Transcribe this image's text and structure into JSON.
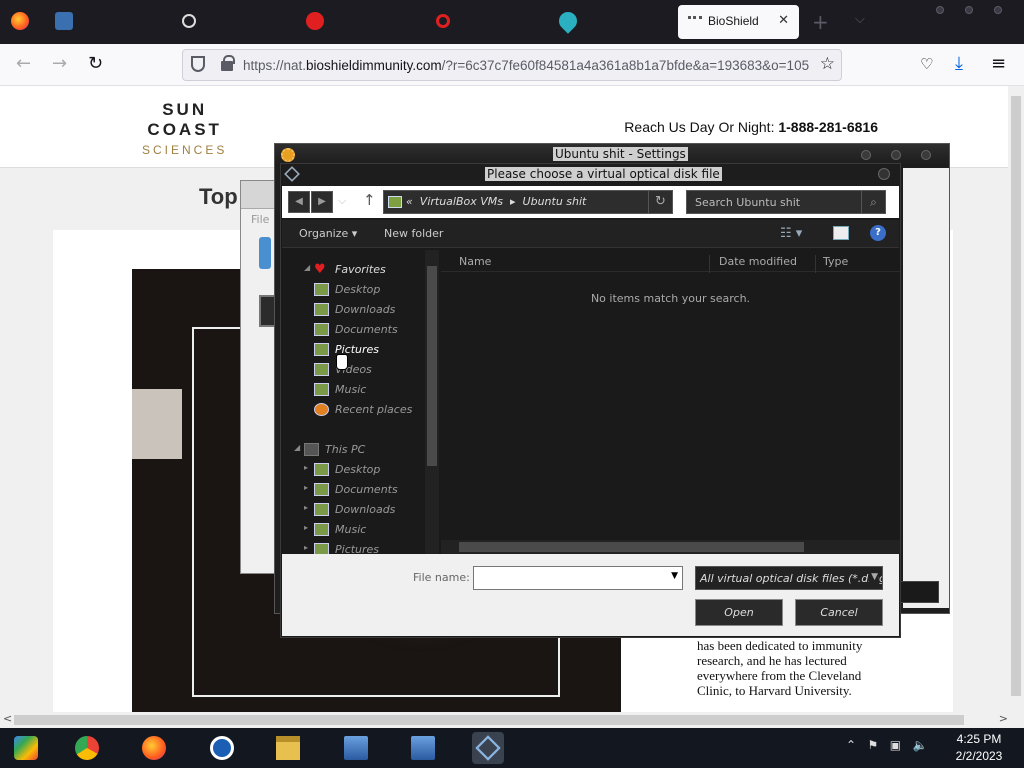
{
  "browser": {
    "active_tab_title": "BioShield",
    "url_prefix": "https://nat.",
    "url_domain": "bioshieldimmunity.com",
    "url_rest": "/?r=6c37c7fe60f84581a4a361a8b1a7bfde&a=193683&o=105"
  },
  "site": {
    "logo": {
      "line1": "SUN",
      "line2": "COAST",
      "line3": "SCIENCES"
    },
    "reach_label": "Reach Us Day Or Night: ",
    "phone": "1-888-281-6816",
    "heading": "Top",
    "bio_text": "has been dedicated to immunity research, and he has lectured everywhere from the Cleveland Clinic, to Harvard University."
  },
  "vbox_manager": {
    "menu_file": "File"
  },
  "settings_window": {
    "title": "Ubuntu shit - Settings"
  },
  "file_dialog": {
    "title": "Please choose a virtual optical disk file",
    "breadcrumb": [
      "VirtualBox VMs",
      "Ubuntu shit"
    ],
    "breadcrumb_prefix": "«",
    "search_placeholder": "Search Ubuntu shit",
    "organize_label": "Organize",
    "new_folder_label": "New folder",
    "nav": {
      "favorites_label": "Favorites",
      "favorites": [
        "Desktop",
        "Downloads",
        "Documents",
        "Pictures",
        "Videos",
        "Music",
        "Recent places"
      ],
      "this_pc_label": "This PC",
      "this_pc": [
        "Desktop",
        "Documents",
        "Downloads",
        "Music",
        "Pictures"
      ]
    },
    "columns": {
      "name": "Name",
      "date_modified": "Date modified",
      "type": "Type"
    },
    "empty_message": "No items match your search.",
    "file_name_label": "File name:",
    "file_name_value": "",
    "file_type": "All virtual optical disk files (*.dmg",
    "open_label": "Open",
    "cancel_label": "Cancel"
  },
  "taskbar": {
    "apps": [
      "chrome-remote-icon",
      "chrome-icon",
      "firefox-icon",
      "opera-icon",
      "file-explorer-icon",
      "virtualbox-setup-icon",
      "virtualbox-setup-icon-2",
      "virtualbox-icon"
    ],
    "time": "4:25 PM",
    "date": "2/2/2023"
  }
}
